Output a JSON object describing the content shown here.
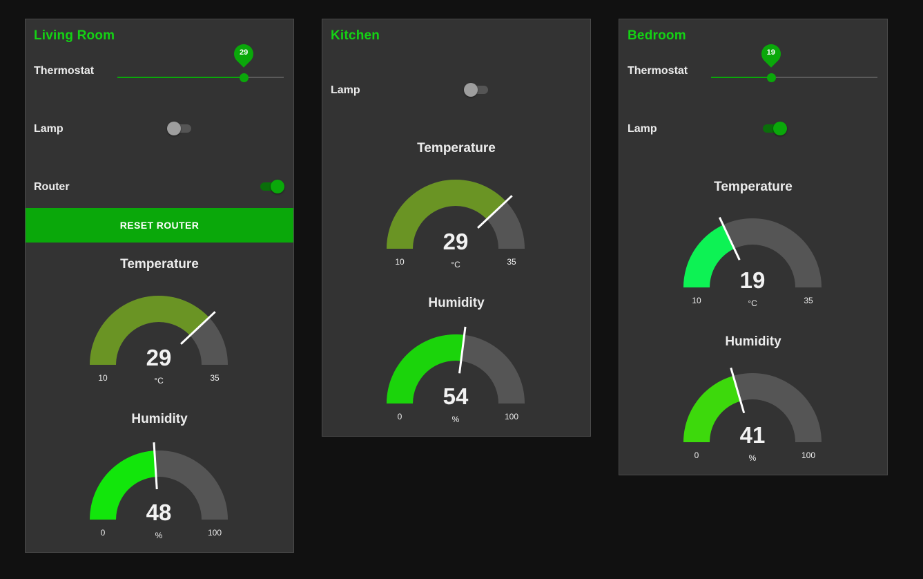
{
  "colors": {
    "accent": "#0aa80a",
    "title": "#14d214",
    "track": "#555555",
    "temp_warm": "#6a9424",
    "temp_cool": "#0df254",
    "hum_kitchen": "#1bd40b",
    "hum_living": "#12e60b",
    "hum_bedroom": "#3dd90c"
  },
  "living": {
    "title": "Living Room",
    "thermostat": {
      "label": "Thermostat",
      "value": "29",
      "fraction": 0.76
    },
    "lamp": {
      "label": "Lamp",
      "on": false
    },
    "router": {
      "label": "Router",
      "on": true
    },
    "reset_button": "RESET ROUTER",
    "temperature": {
      "title": "Temperature",
      "value": "29",
      "unit": "°C",
      "min": "10",
      "max": "35"
    },
    "humidity": {
      "title": "Humidity",
      "value": "48",
      "unit": "%",
      "min": "0",
      "max": "100"
    }
  },
  "kitchen": {
    "title": "Kitchen",
    "lamp": {
      "label": "Lamp",
      "on": false
    },
    "temperature": {
      "title": "Temperature",
      "value": "29",
      "unit": "°C",
      "min": "10",
      "max": "35"
    },
    "humidity": {
      "title": "Humidity",
      "value": "54",
      "unit": "%",
      "min": "0",
      "max": "100"
    }
  },
  "bedroom": {
    "title": "Bedroom",
    "thermostat": {
      "label": "Thermostat",
      "value": "19",
      "fraction": 0.36
    },
    "lamp": {
      "label": "Lamp",
      "on": true
    },
    "temperature": {
      "title": "Temperature",
      "value": "19",
      "unit": "°C",
      "min": "10",
      "max": "35"
    },
    "humidity": {
      "title": "Humidity",
      "value": "41",
      "unit": "%",
      "min": "0",
      "max": "100"
    }
  }
}
